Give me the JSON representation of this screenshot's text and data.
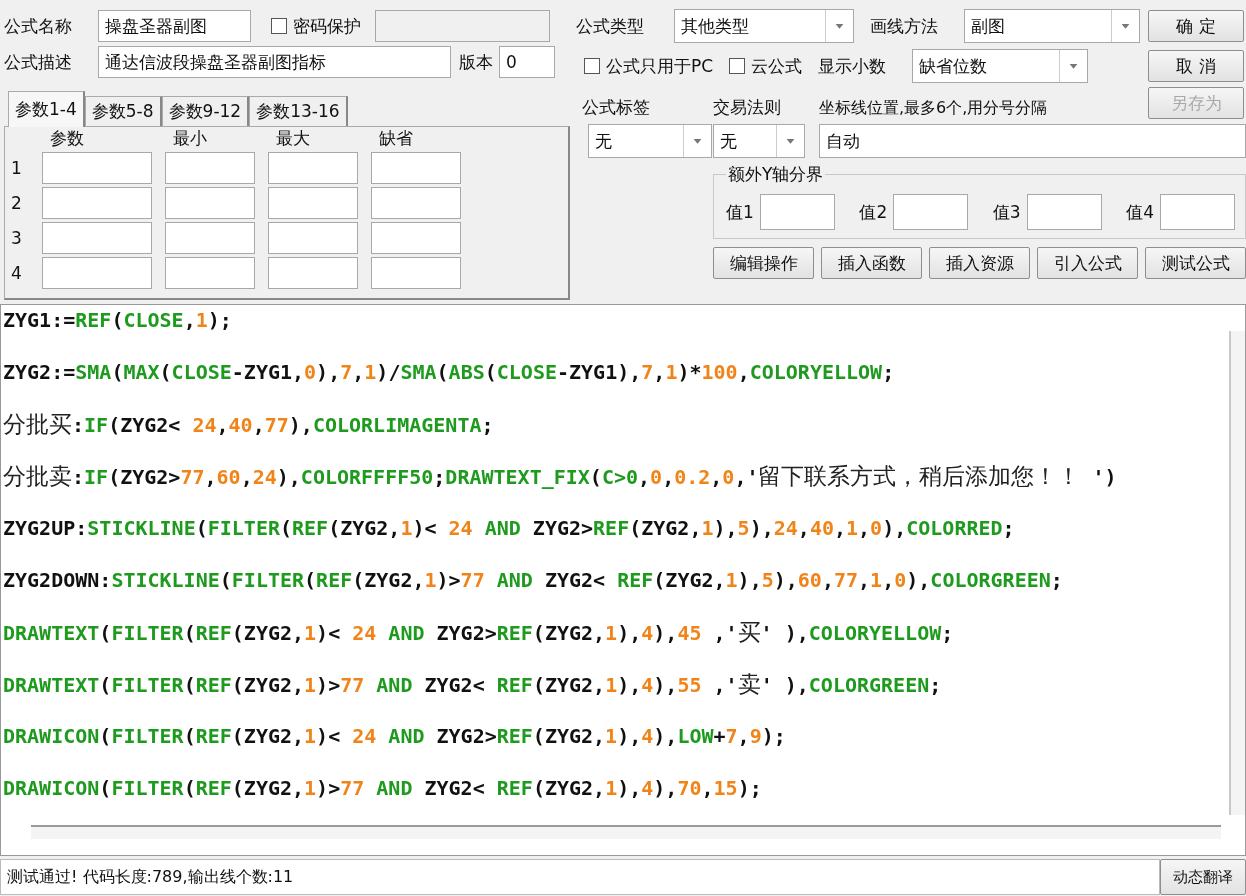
{
  "form": {
    "name_label": "公式名称",
    "name_value": "操盘圣器副图",
    "password": {
      "label": "密码保护",
      "checked": false
    },
    "password_field": {
      "disabled": true
    },
    "desc_label": "公式描述",
    "desc_value": "通达信波段操盘圣器副图指标",
    "version_label": "版本",
    "version_value": "0"
  },
  "param_tabs": [
    {
      "label": "参数1-4",
      "selected": true
    },
    {
      "label": "参数5-8",
      "selected": false
    },
    {
      "label": "参数9-12",
      "selected": false
    },
    {
      "label": "参数13-16",
      "selected": false
    }
  ],
  "params": {
    "columns": [
      "参数",
      "最小",
      "最大",
      "缺省"
    ],
    "rows": [
      "1",
      "2",
      "3",
      "4"
    ]
  },
  "formula_type": {
    "label": "公式类型",
    "value": "其他类型"
  },
  "draw_method": {
    "label": "画线方法",
    "value": "副图"
  },
  "options": [
    {
      "label": "公式只用于PC",
      "checked": false
    },
    {
      "label": "云公式",
      "checked": false
    }
  ],
  "decimals": {
    "label": "显示小数",
    "value": "缺省位数"
  },
  "dialog_buttons": [
    {
      "label": "确 定",
      "disabled": false
    },
    {
      "label": "取 消",
      "disabled": false
    },
    {
      "label": "另存为",
      "disabled": true
    }
  ],
  "tag": {
    "label": "公式标签",
    "value": "无"
  },
  "trade_rule": {
    "label": "交易法则",
    "value": "无"
  },
  "axis_lines": {
    "label": "坐标线位置,最多6个,用分号分隔",
    "value": "自动"
  },
  "y_bounds": {
    "title": "额外Y轴分界",
    "values": [
      {
        "label": "值1"
      },
      {
        "label": "值2"
      },
      {
        "label": "值3"
      },
      {
        "label": "值4"
      }
    ]
  },
  "tool_buttons": [
    "编辑操作",
    "插入函数",
    "插入资源",
    "引入公式",
    "测试公式"
  ],
  "code_lines": [
    {
      "tokens": [
        {
          "kind": "plain",
          "text": "ZYG1:="
        },
        {
          "kind": "func",
          "text": "REF"
        },
        {
          "kind": "plain",
          "text": "("
        },
        {
          "kind": "func",
          "text": "CLOSE"
        },
        {
          "kind": "plain",
          "text": ","
        },
        {
          "kind": "num",
          "text": "1"
        },
        {
          "kind": "plain",
          "text": ");"
        }
      ]
    },
    {
      "tokens": [
        {
          "kind": "plain",
          "text": "ZYG2:="
        },
        {
          "kind": "func",
          "text": "SMA"
        },
        {
          "kind": "plain",
          "text": "("
        },
        {
          "kind": "func",
          "text": "MAX"
        },
        {
          "kind": "plain",
          "text": "("
        },
        {
          "kind": "func",
          "text": "CLOSE"
        },
        {
          "kind": "plain",
          "text": "-ZYG1,"
        },
        {
          "kind": "num",
          "text": "0"
        },
        {
          "kind": "plain",
          "text": "),"
        },
        {
          "kind": "num",
          "text": "7"
        },
        {
          "kind": "plain",
          "text": ","
        },
        {
          "kind": "num",
          "text": "1"
        },
        {
          "kind": "plain",
          "text": ")/"
        },
        {
          "kind": "func",
          "text": "SMA"
        },
        {
          "kind": "plain",
          "text": "("
        },
        {
          "kind": "func",
          "text": "ABS"
        },
        {
          "kind": "plain",
          "text": "("
        },
        {
          "kind": "func",
          "text": "CLOSE"
        },
        {
          "kind": "plain",
          "text": "-ZYG1),"
        },
        {
          "kind": "num",
          "text": "7"
        },
        {
          "kind": "plain",
          "text": ","
        },
        {
          "kind": "num",
          "text": "1"
        },
        {
          "kind": "plain",
          "text": ")*"
        },
        {
          "kind": "num",
          "text": "100"
        },
        {
          "kind": "plain",
          "text": ","
        },
        {
          "kind": "func",
          "text": "COLORYELLOW"
        },
        {
          "kind": "plain",
          "text": ";"
        }
      ]
    },
    {
      "tokens": [
        {
          "kind": "cjk",
          "text": "分批买"
        },
        {
          "kind": "plain",
          "text": ":"
        },
        {
          "kind": "func",
          "text": "IF"
        },
        {
          "kind": "plain",
          "text": "(ZYG2< "
        },
        {
          "kind": "num",
          "text": "24"
        },
        {
          "kind": "plain",
          "text": ","
        },
        {
          "kind": "num",
          "text": "40"
        },
        {
          "kind": "plain",
          "text": ","
        },
        {
          "kind": "num",
          "text": "77"
        },
        {
          "kind": "plain",
          "text": "),"
        },
        {
          "kind": "func",
          "text": "COLORLIMAGENTA"
        },
        {
          "kind": "plain",
          "text": ";"
        }
      ]
    },
    {
      "tokens": [
        {
          "kind": "cjk",
          "text": "分批卖"
        },
        {
          "kind": "plain",
          "text": ":"
        },
        {
          "kind": "func",
          "text": "IF"
        },
        {
          "kind": "plain",
          "text": "(ZYG2>"
        },
        {
          "kind": "num",
          "text": "77"
        },
        {
          "kind": "plain",
          "text": ","
        },
        {
          "kind": "num",
          "text": "60"
        },
        {
          "kind": "plain",
          "text": ","
        },
        {
          "kind": "num",
          "text": "24"
        },
        {
          "kind": "plain",
          "text": "),"
        },
        {
          "kind": "func",
          "text": "COLORFFFF50"
        },
        {
          "kind": "plain",
          "text": ";"
        },
        {
          "kind": "func",
          "text": "DRAWTEXT_FIX"
        },
        {
          "kind": "plain",
          "text": "("
        },
        {
          "kind": "func",
          "text": "C>0"
        },
        {
          "kind": "plain",
          "text": ","
        },
        {
          "kind": "num",
          "text": "0"
        },
        {
          "kind": "plain",
          "text": ","
        },
        {
          "kind": "num",
          "text": "0.2"
        },
        {
          "kind": "plain",
          "text": ","
        },
        {
          "kind": "num",
          "text": "0"
        },
        {
          "kind": "plain",
          "text": ",'"
        },
        {
          "kind": "cjk",
          "text": "留下联系方式，稍后添加您！！"
        },
        {
          "kind": "plain",
          "text": " ')"
        }
      ]
    },
    {
      "tokens": [
        {
          "kind": "plain",
          "text": "ZYG2UP:"
        },
        {
          "kind": "func",
          "text": "STICKLINE"
        },
        {
          "kind": "plain",
          "text": "("
        },
        {
          "kind": "func",
          "text": "FILTER"
        },
        {
          "kind": "plain",
          "text": "("
        },
        {
          "kind": "func",
          "text": "REF"
        },
        {
          "kind": "plain",
          "text": "(ZYG2,"
        },
        {
          "kind": "num",
          "text": "1"
        },
        {
          "kind": "plain",
          "text": ")< "
        },
        {
          "kind": "num",
          "text": "24"
        },
        {
          "kind": "func",
          "text": " AND"
        },
        {
          "kind": "plain",
          "text": " ZYG2>"
        },
        {
          "kind": "func",
          "text": "REF"
        },
        {
          "kind": "plain",
          "text": "(ZYG2,"
        },
        {
          "kind": "num",
          "text": "1"
        },
        {
          "kind": "plain",
          "text": "),"
        },
        {
          "kind": "num",
          "text": "5"
        },
        {
          "kind": "plain",
          "text": "),"
        },
        {
          "kind": "num",
          "text": "24"
        },
        {
          "kind": "plain",
          "text": ","
        },
        {
          "kind": "num",
          "text": "40"
        },
        {
          "kind": "plain",
          "text": ","
        },
        {
          "kind": "num",
          "text": "1"
        },
        {
          "kind": "plain",
          "text": ","
        },
        {
          "kind": "num",
          "text": "0"
        },
        {
          "kind": "plain",
          "text": "),"
        },
        {
          "kind": "func",
          "text": "COLORRED"
        },
        {
          "kind": "plain",
          "text": ";"
        }
      ]
    },
    {
      "tokens": [
        {
          "kind": "plain",
          "text": "ZYG2DOWN:"
        },
        {
          "kind": "func",
          "text": "STICKLINE"
        },
        {
          "kind": "plain",
          "text": "("
        },
        {
          "kind": "func",
          "text": "FILTER"
        },
        {
          "kind": "plain",
          "text": "("
        },
        {
          "kind": "func",
          "text": "REF"
        },
        {
          "kind": "plain",
          "text": "(ZYG2,"
        },
        {
          "kind": "num",
          "text": "1"
        },
        {
          "kind": "plain",
          "text": ")>"
        },
        {
          "kind": "num",
          "text": "77"
        },
        {
          "kind": "func",
          "text": " AND"
        },
        {
          "kind": "plain",
          "text": " ZYG2< "
        },
        {
          "kind": "func",
          "text": "REF"
        },
        {
          "kind": "plain",
          "text": "(ZYG2,"
        },
        {
          "kind": "num",
          "text": "1"
        },
        {
          "kind": "plain",
          "text": "),"
        },
        {
          "kind": "num",
          "text": "5"
        },
        {
          "kind": "plain",
          "text": "),"
        },
        {
          "kind": "num",
          "text": "60"
        },
        {
          "kind": "plain",
          "text": ","
        },
        {
          "kind": "num",
          "text": "77"
        },
        {
          "kind": "plain",
          "text": ","
        },
        {
          "kind": "num",
          "text": "1"
        },
        {
          "kind": "plain",
          "text": ","
        },
        {
          "kind": "num",
          "text": "0"
        },
        {
          "kind": "plain",
          "text": "),"
        },
        {
          "kind": "func",
          "text": "COLORGREEN"
        },
        {
          "kind": "plain",
          "text": ";"
        }
      ]
    },
    {
      "tokens": [
        {
          "kind": "func",
          "text": "DRAWTEXT"
        },
        {
          "kind": "plain",
          "text": "("
        },
        {
          "kind": "func",
          "text": "FILTER"
        },
        {
          "kind": "plain",
          "text": "("
        },
        {
          "kind": "func",
          "text": "REF"
        },
        {
          "kind": "plain",
          "text": "(ZYG2,"
        },
        {
          "kind": "num",
          "text": "1"
        },
        {
          "kind": "plain",
          "text": ")< "
        },
        {
          "kind": "num",
          "text": "24"
        },
        {
          "kind": "func",
          "text": " AND"
        },
        {
          "kind": "plain",
          "text": " ZYG2>"
        },
        {
          "kind": "func",
          "text": "REF"
        },
        {
          "kind": "plain",
          "text": "(ZYG2,"
        },
        {
          "kind": "num",
          "text": "1"
        },
        {
          "kind": "plain",
          "text": "),"
        },
        {
          "kind": "num",
          "text": "4"
        },
        {
          "kind": "plain",
          "text": "),"
        },
        {
          "kind": "num",
          "text": "45"
        },
        {
          "kind": "plain",
          "text": " ,'"
        },
        {
          "kind": "cjk",
          "text": "买"
        },
        {
          "kind": "plain",
          "text": "' ),"
        },
        {
          "kind": "func",
          "text": "COLORYELLOW"
        },
        {
          "kind": "plain",
          "text": ";"
        }
      ]
    },
    {
      "tokens": [
        {
          "kind": "func",
          "text": "DRAWTEXT"
        },
        {
          "kind": "plain",
          "text": "("
        },
        {
          "kind": "func",
          "text": "FILTER"
        },
        {
          "kind": "plain",
          "text": "("
        },
        {
          "kind": "func",
          "text": "REF"
        },
        {
          "kind": "plain",
          "text": "(ZYG2,"
        },
        {
          "kind": "num",
          "text": "1"
        },
        {
          "kind": "plain",
          "text": ")>"
        },
        {
          "kind": "num",
          "text": "77"
        },
        {
          "kind": "func",
          "text": " AND"
        },
        {
          "kind": "plain",
          "text": " ZYG2< "
        },
        {
          "kind": "func",
          "text": "REF"
        },
        {
          "kind": "plain",
          "text": "(ZYG2,"
        },
        {
          "kind": "num",
          "text": "1"
        },
        {
          "kind": "plain",
          "text": "),"
        },
        {
          "kind": "num",
          "text": "4"
        },
        {
          "kind": "plain",
          "text": "),"
        },
        {
          "kind": "num",
          "text": "55"
        },
        {
          "kind": "plain",
          "text": " ,'"
        },
        {
          "kind": "cjk",
          "text": "卖"
        },
        {
          "kind": "plain",
          "text": "' ),"
        },
        {
          "kind": "func",
          "text": "COLORGREEN"
        },
        {
          "kind": "plain",
          "text": ";"
        }
      ]
    },
    {
      "tokens": [
        {
          "kind": "func",
          "text": "DRAWICON"
        },
        {
          "kind": "plain",
          "text": "("
        },
        {
          "kind": "func",
          "text": "FILTER"
        },
        {
          "kind": "plain",
          "text": "("
        },
        {
          "kind": "func",
          "text": "REF"
        },
        {
          "kind": "plain",
          "text": "(ZYG2,"
        },
        {
          "kind": "num",
          "text": "1"
        },
        {
          "kind": "plain",
          "text": ")< "
        },
        {
          "kind": "num",
          "text": "24"
        },
        {
          "kind": "func",
          "text": " AND"
        },
        {
          "kind": "plain",
          "text": " ZYG2>"
        },
        {
          "kind": "func",
          "text": "REF"
        },
        {
          "kind": "plain",
          "text": "(ZYG2,"
        },
        {
          "kind": "num",
          "text": "1"
        },
        {
          "kind": "plain",
          "text": "),"
        },
        {
          "kind": "num",
          "text": "4"
        },
        {
          "kind": "plain",
          "text": "),"
        },
        {
          "kind": "func",
          "text": "LOW"
        },
        {
          "kind": "plain",
          "text": "+"
        },
        {
          "kind": "num",
          "text": "7"
        },
        {
          "kind": "plain",
          "text": ","
        },
        {
          "kind": "num",
          "text": "9"
        },
        {
          "kind": "plain",
          "text": ");"
        }
      ]
    },
    {
      "tokens": [
        {
          "kind": "func",
          "text": "DRAWICON"
        },
        {
          "kind": "plain",
          "text": "("
        },
        {
          "kind": "func",
          "text": "FILTER"
        },
        {
          "kind": "plain",
          "text": "("
        },
        {
          "kind": "func",
          "text": "REF"
        },
        {
          "kind": "plain",
          "text": "(ZYG2,"
        },
        {
          "kind": "num",
          "text": "1"
        },
        {
          "kind": "plain",
          "text": ")>"
        },
        {
          "kind": "num",
          "text": "77"
        },
        {
          "kind": "func",
          "text": " AND"
        },
        {
          "kind": "plain",
          "text": " ZYG2< "
        },
        {
          "kind": "func",
          "text": "REF"
        },
        {
          "kind": "plain",
          "text": "(ZYG2,"
        },
        {
          "kind": "num",
          "text": "1"
        },
        {
          "kind": "plain",
          "text": "),"
        },
        {
          "kind": "num",
          "text": "4"
        },
        {
          "kind": "plain",
          "text": "),"
        },
        {
          "kind": "num",
          "text": "70"
        },
        {
          "kind": "plain",
          "text": ","
        },
        {
          "kind": "num",
          "text": "15"
        },
        {
          "kind": "plain",
          "text": ");"
        }
      ]
    }
  ],
  "status": {
    "message": "测试通过! 代码长度:789,输出线个数:11",
    "button": "动态翻译"
  }
}
